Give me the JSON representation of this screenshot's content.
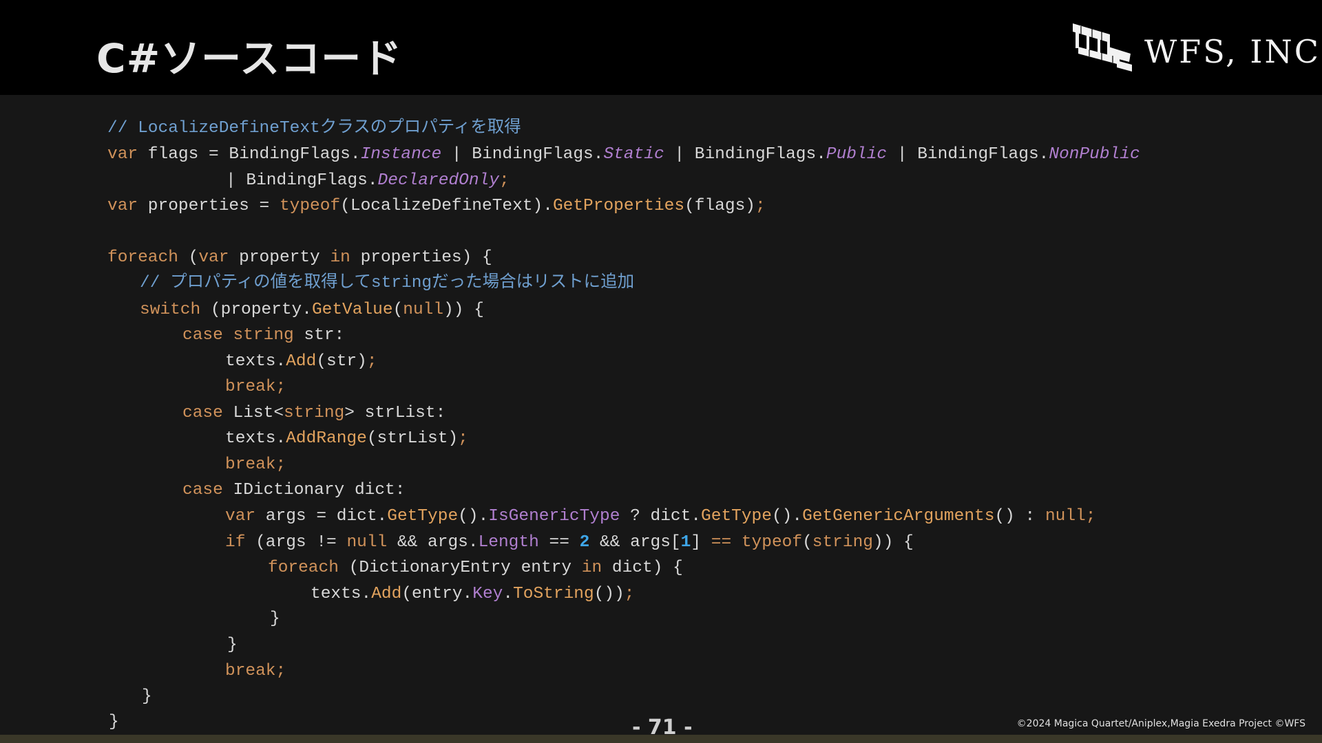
{
  "header": {
    "title": "C#ソースコード",
    "logo_text": "WFS, INC."
  },
  "code": {
    "l1_comment": "// LocalizeDefineTextクラスのプロパティを取得",
    "l2_var": "var",
    "l2_a": " flags = BindingFlags.",
    "l2_instance": "Instance",
    "l2_b": " | BindingFlags.",
    "l2_static": "Static",
    "l2_c": " | BindingFlags.",
    "l2_public": "Public",
    "l2_d": " | BindingFlags.",
    "l2_nonpublic": "NonPublic",
    "l3_a": "| BindingFlags.",
    "l3_declared": "DeclaredOnly",
    "l3_semi": ";",
    "l4_var": "var",
    "l4_a": " properties = ",
    "l4_typeof": "typeof",
    "l4_b": "(LocalizeDefineText).",
    "l4_getprops": "GetProperties",
    "l4_c": "(flags)",
    "l4_semi": ";",
    "l5_foreach": "foreach",
    "l5_a": " (",
    "l5_var": "var",
    "l5_b": " property ",
    "l5_in": "in",
    "l5_c": " properties) {",
    "l6_comment": "// プロパティの値を取得してstringだった場合はリストに追加",
    "l7_switch": "switch",
    "l7_a": " (property.",
    "l7_getvalue": "GetValue",
    "l7_b": "(",
    "l7_null": "null",
    "l7_c": ")) {",
    "l8_case": "case",
    "l8_string": " string",
    "l8_a": " str:",
    "l9_a": "texts.",
    "l9_add": "Add",
    "l9_b": "(str)",
    "l9_semi": ";",
    "l10_break": "break;",
    "l11_case": "case",
    "l11_a": " List<",
    "l11_string": "string",
    "l11_b": "> strList:",
    "l12_a": "texts.",
    "l12_addrange": "AddRange",
    "l12_b": "(strList)",
    "l12_semi": ";",
    "l13_break": "break;",
    "l14_case": "case",
    "l14_a": " IDictionary dict:",
    "l15_var": "var",
    "l15_a": " args = dict.",
    "l15_gettype": "GetType",
    "l15_b": "().",
    "l15_isgeneric": "IsGenericType",
    "l15_c": " ? dict.",
    "l15_gettype2": "GetType",
    "l15_d": "().",
    "l15_getgeneric": "GetGenericArguments",
    "l15_e": "() : ",
    "l15_null": "null;",
    "l16_if": "if",
    "l16_a": " (args != ",
    "l16_null": "null",
    "l16_b": " && args.",
    "l16_length": "Length",
    "l16_c": " == ",
    "l16_two": "2",
    "l16_d": " && args[",
    "l16_one": "1",
    "l16_e": "] ",
    "l16_eq": "==",
    "l16_f": " ",
    "l16_typeof": "typeof",
    "l16_g": "(",
    "l16_string": "string",
    "l16_h": ")) {",
    "l17_foreach": "foreach",
    "l17_a": " (DictionaryEntry entry ",
    "l17_in": "in",
    "l17_b": " dict) {",
    "l18_a": "texts.",
    "l18_add": "Add",
    "l18_b": "(entry.",
    "l18_key": "Key",
    "l18_c": ".",
    "l18_tostring": "ToString",
    "l18_d": "())",
    "l18_semi": ";",
    "l19_brace": "}",
    "l20_brace": "}",
    "l21_break": "break;",
    "l22_brace": "}",
    "l23_brace": "}"
  },
  "footer": {
    "page": "- 71 -",
    "copyright": "©2024 Magica Quartet/Aniplex,Magia Exedra Project ©WFS"
  },
  "colors": {
    "background": "#000000",
    "code_background": "#171717",
    "keyword": "#d0925a",
    "property": "#b07fcf",
    "method": "#e2a35e",
    "comment": "#6f9fcf",
    "number": "#3ea6e8"
  }
}
